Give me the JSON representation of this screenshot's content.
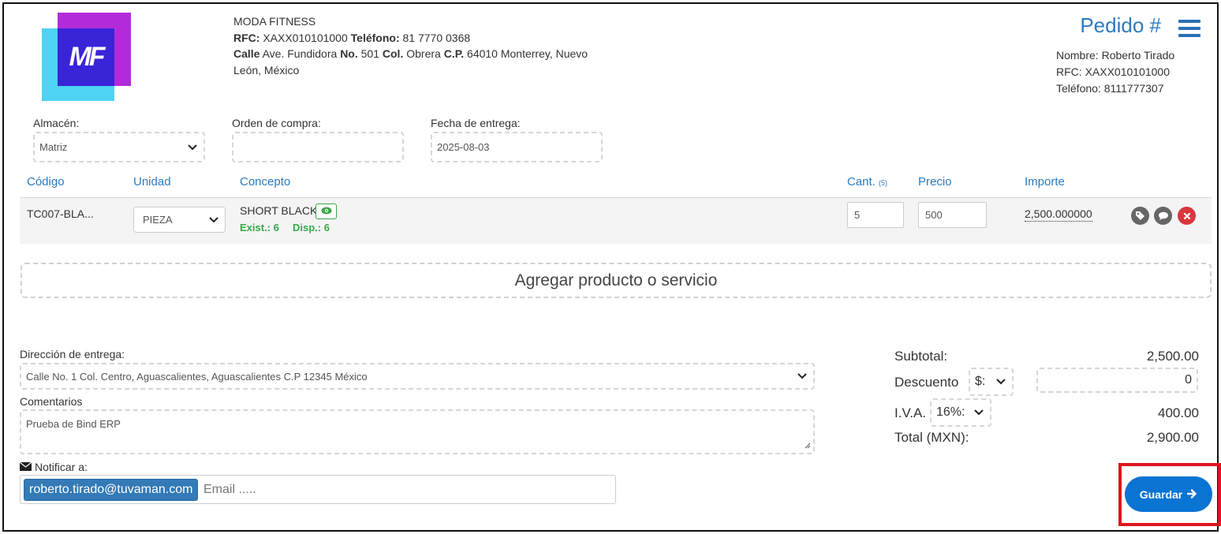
{
  "company": {
    "name": "MODA FITNESS",
    "logo_text": "MF",
    "rfc_label": "RFC:",
    "rfc": "XAXX010101000",
    "phone_label": "Teléfono:",
    "phone": "81 7770 0368",
    "street_label": "Calle",
    "street": "Ave. Fundidora",
    "number_label": "No.",
    "number": "501",
    "col_label": "Col.",
    "col": "Obrera",
    "cp_label": "C.P.",
    "cp_city": "64010 Monterrey, Nuevo",
    "state": "León, México"
  },
  "header": {
    "title": "Pedido #"
  },
  "client": {
    "name_label": "Nombre:",
    "name": "Roberto Tirado",
    "rfc_label": "RFC:",
    "rfc": "XAXX010101000",
    "phone_label": "Teléfono:",
    "phone": "8111777307"
  },
  "form": {
    "warehouse_label": "Almacén:",
    "warehouse_value": "Matriz",
    "po_label": "Orden de compra:",
    "po_value": "",
    "delivery_date_label": "Fecha de entrega:",
    "delivery_date_value": "2025-08-03"
  },
  "table": {
    "col_code": "Código",
    "col_unit": "Unidad",
    "col_concept": "Concepto",
    "col_qty": "Cant.",
    "col_qty_count": "(5)",
    "col_price": "Precio",
    "col_amount": "Importe",
    "rows": [
      {
        "code": "TC007-BLA...",
        "unit": "PIEZA",
        "concept": "SHORT BLACK",
        "exist": "Exist.: 6",
        "disp": "Disp.: 6",
        "qty": "5",
        "price": "500",
        "amount": "2,500.000000"
      }
    ]
  },
  "add_product_label": "Agregar producto o servicio",
  "delivery": {
    "address_label": "Dirección de entrega:",
    "address_value": "Calle No. 1  Col. Centro,  Aguascalientes, Aguascalientes  C.P 12345 México",
    "comments_label": "Comentarios",
    "comments_value": "Prueba de Bind ERP",
    "notify_label": "Notificar a:",
    "notify_email": "roberto.tirado@tuvaman.com",
    "email_placeholder": "Email ....."
  },
  "totals": {
    "subtotal_label": "Subtotal:",
    "subtotal": "2,500.00",
    "discount_label": "Descuento",
    "discount_type": "$:",
    "discount_value": "0",
    "iva_label": "I.V.A.",
    "iva_rate": "16%:",
    "iva": "400.00",
    "total_label": "Total (MXN):",
    "total": "2,900.00"
  },
  "actions": {
    "save_label": "Guardar"
  },
  "colors": {
    "accent_blue": "#2b7bc2",
    "save_blue": "#0a74d3",
    "stock_green": "#3aa64a",
    "highlight_red": "#e0151b"
  }
}
